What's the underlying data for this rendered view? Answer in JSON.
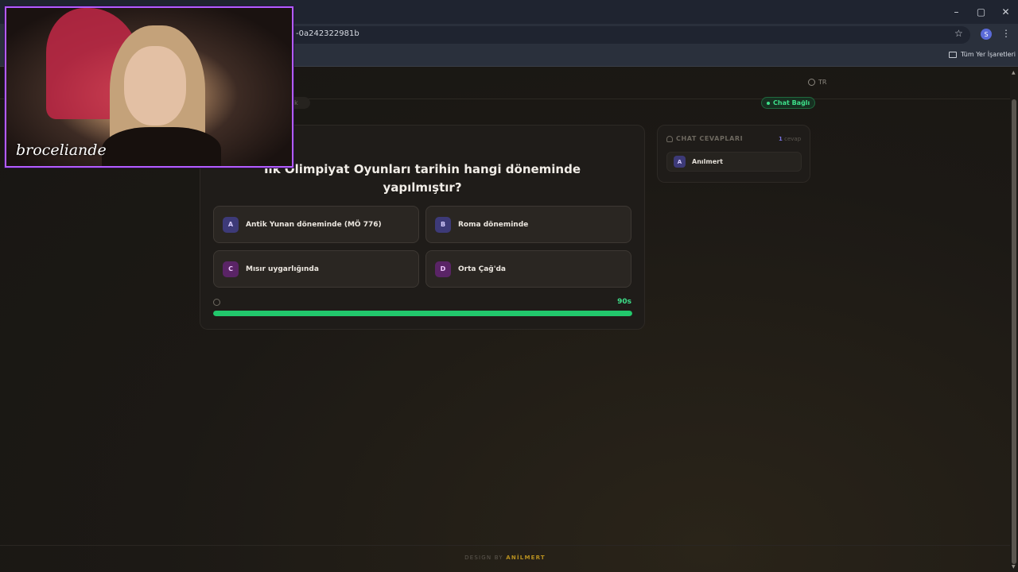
{
  "browser": {
    "url_fragment": "-0a242322981b",
    "bookmarks_label": "Tüm Yer İşaretleri",
    "profile_initial": "S",
    "window_controls": [
      "–",
      "▢",
      "✕"
    ]
  },
  "header": {
    "language": "TR",
    "chat_status": "Chat Bağlı",
    "hidden_chip": "k"
  },
  "question": {
    "text": "İlk Olimpiyat Oyunları tarihin hangi döneminde yapılmıştır?",
    "options": [
      {
        "letter": "A",
        "text": "Antik Yunan döneminde (MÖ 776)"
      },
      {
        "letter": "B",
        "text": "Roma döneminde"
      },
      {
        "letter": "C",
        "text": "Mısır uygarlığında"
      },
      {
        "letter": "D",
        "text": "Orta Çağ'da"
      }
    ],
    "timer": "90s",
    "progress_fraction": 1.0
  },
  "chat_panel": {
    "title": "CHAT CEVAPLARI",
    "count": "1",
    "count_suffix": "cevap",
    "answers": [
      {
        "letter": "A",
        "user": "Anılmert"
      }
    ]
  },
  "footer": {
    "prefix": "DESIGN BY ",
    "brand": "ANİLMERT"
  },
  "webcam": {
    "watermark": "broceliande"
  },
  "colors": {
    "accent_green": "#22c86c",
    "webcam_border": "#b35cff",
    "footer_brand": "#b8901f"
  }
}
